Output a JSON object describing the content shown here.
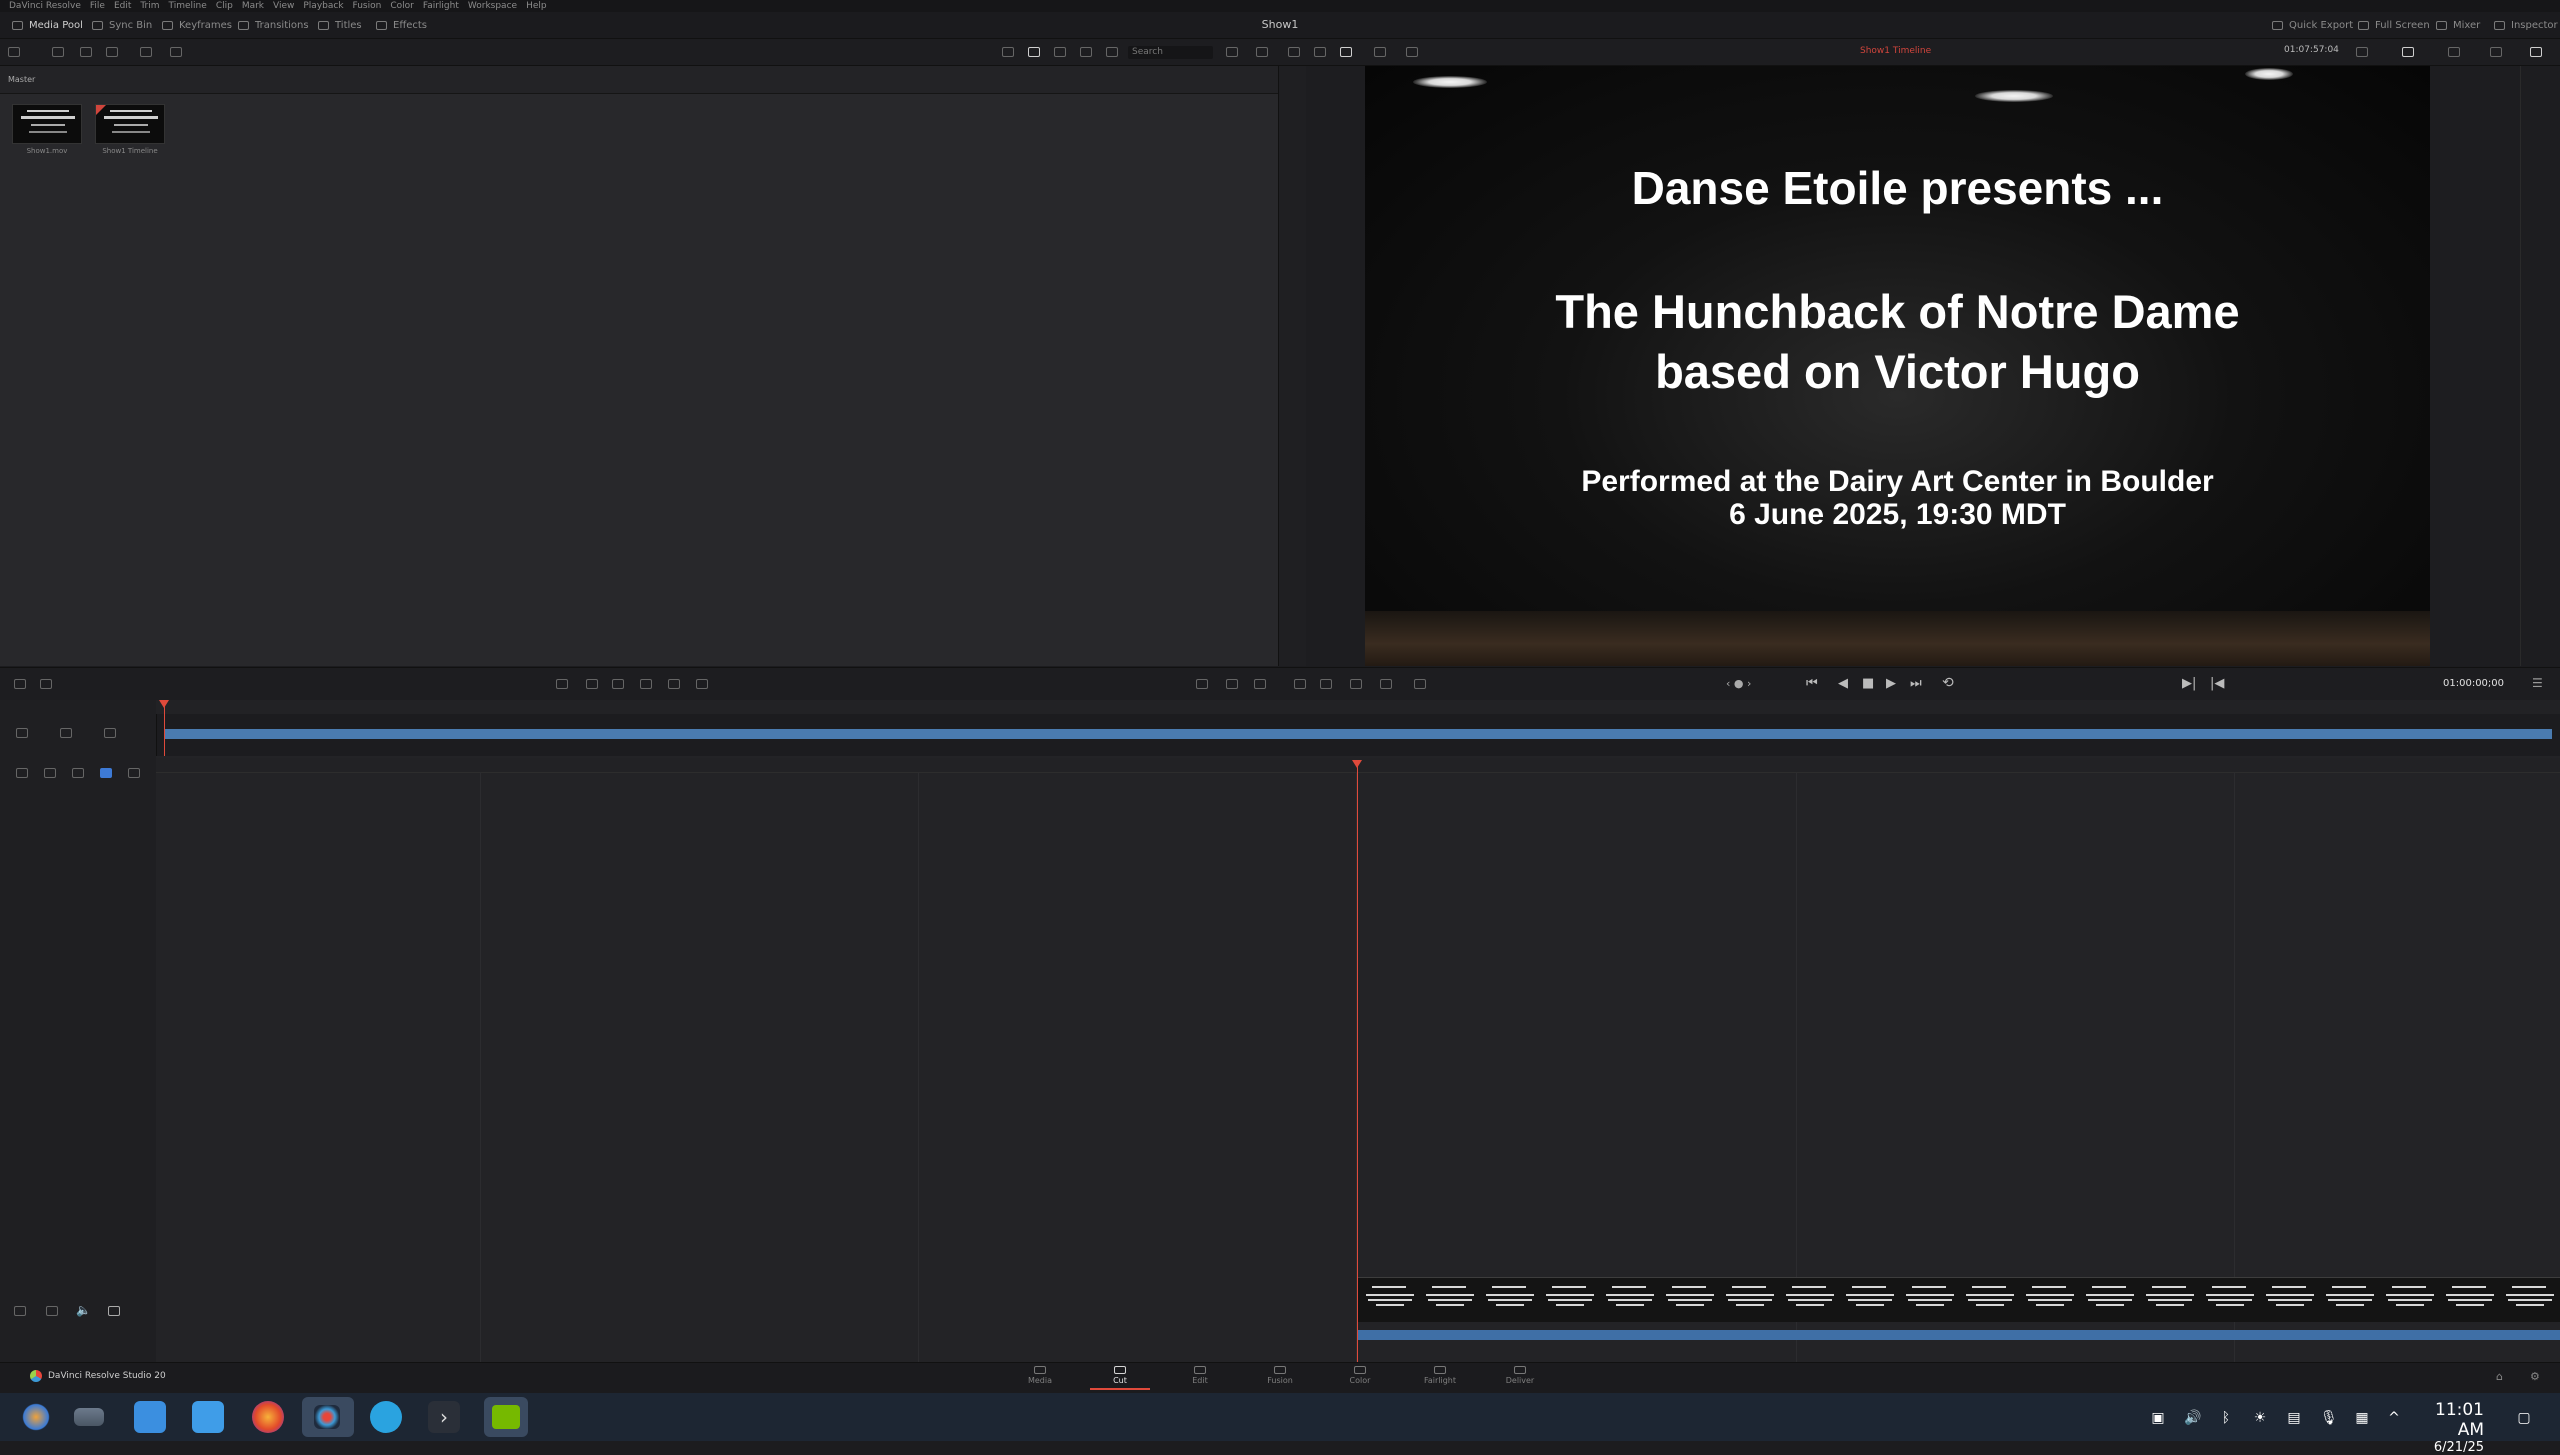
{
  "menu": [
    "DaVinci Resolve",
    "File",
    "Edit",
    "Trim",
    "Timeline",
    "Clip",
    "Mark",
    "View",
    "Playback",
    "Fusion",
    "Color",
    "Fairlight",
    "Workspace",
    "Help"
  ],
  "window_title": "Show1",
  "toolbar_left": {
    "media_pool": "Media Pool",
    "sync_bin": "Sync Bin",
    "keyframes": "Keyframes",
    "transitions": "Transitions",
    "titles": "Titles",
    "effects": "Effects"
  },
  "toolbar_right": {
    "quick_export": "Quick Export",
    "full_screen": "Full Screen",
    "mixer": "Mixer",
    "inspector": "Inspector"
  },
  "search_placeholder": "Search",
  "timeline_name": "Show1 Timeline",
  "source_timecode": "01:07:57:04",
  "bin_name": "Master",
  "clips": [
    {
      "label": "Show1.mov"
    },
    {
      "label": "Show1 Timeline"
    }
  ],
  "viewer": {
    "line1": "Danse Etoile presents ...",
    "line2": "The Hunchback of Notre Dame",
    "line3": "based on Victor Hugo",
    "line4": "Performed at the Dairy Art Center in Boulder",
    "line5": "6 June 2025, 19:30 MDT"
  },
  "transport_timecode": "01:00:00;00",
  "pages": [
    "Media",
    "Cut",
    "Edit",
    "Fusion",
    "Color",
    "Fairlight",
    "Deliver"
  ],
  "active_page": "Cut",
  "brand": "DaVinci Resolve Studio 20",
  "clock": {
    "time": "11:01 AM",
    "date": "6/21/25"
  },
  "icons": [
    "davinci-logo-icon",
    "play-icon",
    "stop-icon",
    "rewind-icon",
    "fast-forward-icon",
    "loop-icon",
    "volume-icon",
    "bluetooth-icon",
    "brightness-icon",
    "microphone-icon",
    "chevron-up-icon",
    "notification-icon"
  ]
}
